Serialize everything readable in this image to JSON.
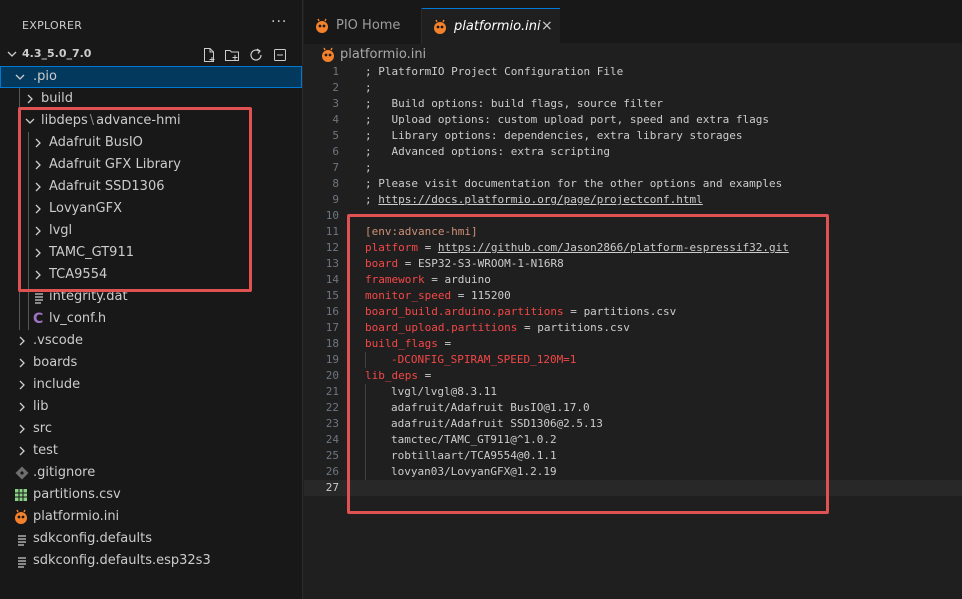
{
  "sidebar": {
    "title": "EXPLORER",
    "more": "···",
    "root_folder": "4.3_5.0_7.0",
    "tree": {
      "pio": ".pio",
      "build": "build",
      "libdeps": "libdeps",
      "libdeps_env": "advance-hmi",
      "libs": [
        "Adafruit BusIO",
        "Adafruit GFX Library",
        "Adafruit SSD1306",
        "LovyanGFX",
        "lvgl",
        "TAMC_GT911",
        "TCA9554"
      ],
      "integrity": "integrity.dat",
      "lv_conf": "lv_conf.h",
      "folders": [
        ".vscode",
        "boards",
        "include",
        "lib",
        "src",
        "test"
      ],
      "files": [
        ".gitignore",
        "partitions.csv",
        "platformio.ini",
        "sdkconfig.defaults",
        "sdkconfig.defaults.esp32s3"
      ]
    }
  },
  "tabs": {
    "home": "PIO Home",
    "active": "platformio.ini",
    "close_glyph": "×"
  },
  "breadcrumb": "platformio.ini",
  "code": {
    "line_numbers": [
      "1",
      "2",
      "3",
      "4",
      "5",
      "6",
      "7",
      "8",
      "9",
      "10",
      "11",
      "12",
      "13",
      "14",
      "15",
      "16",
      "17",
      "18",
      "19",
      "20",
      "21",
      "22",
      "23",
      "24",
      "25",
      "26",
      "27"
    ],
    "comments": [
      "; PlatformIO Project Configuration File",
      ";",
      ";   Build options: build flags, source filter",
      ";   Upload options: custom upload port, speed and extra flags",
      ";   Library options: dependencies, extra library storages",
      ";   Advanced options: extra scripting",
      ";",
      "; Please visit documentation for the other options and examples"
    ],
    "doc_prefix": "; ",
    "doc_url": "https://docs.platformio.org/page/projectconf.html",
    "section": "[env:advance-hmi]",
    "platform_key": "platform",
    "platform_url": "https://github.com/Jason2866/platform-espressif32.git",
    "board_key": "board",
    "board_val": "ESP32-S3-WROOM-1-N16R8",
    "framework_key": "framework",
    "framework_val": "arduino",
    "monitor_key": "monitor_speed",
    "monitor_val": "115200",
    "bbap_key": "board_build.arduino.partitions",
    "bbap_val": "partitions.csv",
    "bup_key": "board_upload.partitions",
    "bup_val": "partitions.csv",
    "flags_key": "build_flags",
    "flags_val": "-DCONFIG_SPIRAM_SPEED_120M=1",
    "lib_deps_key": "lib_deps",
    "eq": " = ",
    "eq_end": " =",
    "lib_deps": [
      "lvgl/lvgl@8.3.11",
      "adafruit/Adafruit BusIO@1.17.0",
      "adafruit/Adafruit SSD1306@2.5.13",
      "tamctec/TAMC_GT911@^1.0.2",
      "robtillaart/TCA9554@0.1.1",
      "lovyan03/LovyanGFX@1.2.19"
    ]
  },
  "colors": {
    "accent": "#0078d4",
    "highlight_box": "#e05252",
    "pio_orange": "#f5822a",
    "csv_green": "#89d185",
    "h_purple": "#a074c4"
  }
}
